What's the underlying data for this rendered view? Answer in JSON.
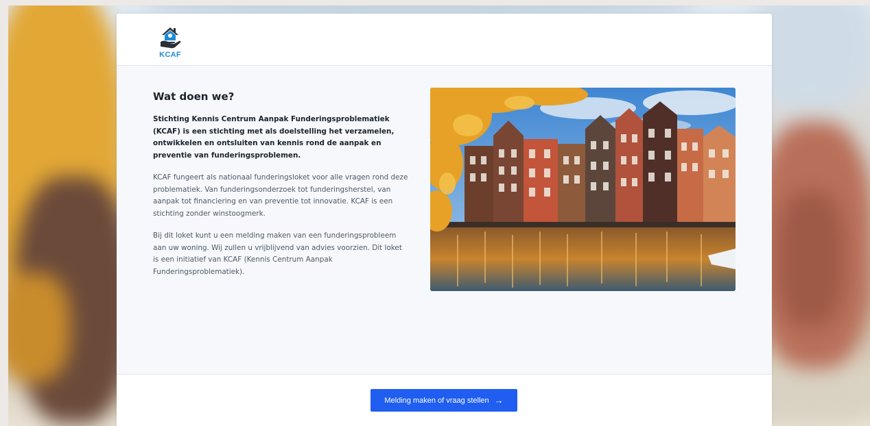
{
  "brand": {
    "logo_text": "KCAF",
    "logo_icon": "house-hand-logo-icon",
    "accent_color": "#1e8bd6"
  },
  "about": {
    "title": "Wat doen we?",
    "lead": "Stichting Kennis Centrum Aanpak Funderingsproblematiek (KCAF) is een stichting met als doelstelling het verzamelen, ontwikkelen en ontsluiten van kennis rond de aanpak en preventie van funderingsproblemen.",
    "paragraph_1": "KCAF fungeert als nationaal funderingsloket voor alle vragen rond deze problematiek. Van funderingsonderzoek tot funderingsherstel, van aanpak tot financiering en van preventie tot innovatie. KCAF is een stichting zonder winstoogmerk.",
    "paragraph_2": "Bij dit loket kunt u een melding maken van een funderingsprobleem aan uw woning. Wij zullen u vrijblijvend van advies voorzien. Dit loket is een initiatief van KCAF (Kennis Centrum Aanpak Funderingsproblematiek)."
  },
  "footer": {
    "cta_label": "Melding maken of vraag stellen",
    "cta_icon": "arrow-right-icon",
    "cta_color": "#1f5ef0"
  }
}
